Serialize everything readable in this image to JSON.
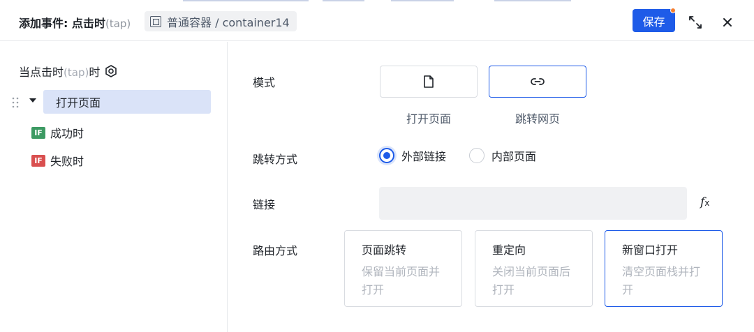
{
  "header": {
    "title": "添加事件: 点击时",
    "title_paren": "(tap)",
    "breadcrumb": "普通容器 / container14",
    "save_label": "保存"
  },
  "sidebar": {
    "trigger_prefix": "当点击时",
    "trigger_paren": "(tap)",
    "trigger_suffix": "时",
    "action_label": "打开页面",
    "branches": [
      {
        "badge": "IF",
        "label": "成功时",
        "color": "#3d9a63"
      },
      {
        "badge": "IF",
        "label": "失败时",
        "color": "#d94f4f"
      }
    ]
  },
  "form": {
    "mode_label": "模式",
    "modes": [
      {
        "label": "打开页面",
        "icon": "file-icon",
        "selected": false
      },
      {
        "label": "跳转网页",
        "icon": "link-icon",
        "selected": true
      }
    ],
    "jump_label": "跳转方式",
    "jump_options": [
      {
        "label": "外部链接",
        "selected": true
      },
      {
        "label": "内部页面",
        "selected": false
      }
    ],
    "link_label": "链接",
    "link_value": "",
    "fx_label": "fx",
    "route_label": "路由方式",
    "routes": [
      {
        "title": "页面跳转",
        "desc": "保留当前页面并打开",
        "selected": false
      },
      {
        "title": "重定向",
        "desc": "关闭当前页面后打开",
        "selected": false
      },
      {
        "title": "新窗口打开",
        "desc": "清空页面栈并打开",
        "selected": true
      }
    ]
  },
  "colors": {
    "accent": "#1e5be8",
    "selected_bg": "#dae3f8",
    "input_bg": "#f0f1f3",
    "notify_dot": "#f57d2c"
  }
}
